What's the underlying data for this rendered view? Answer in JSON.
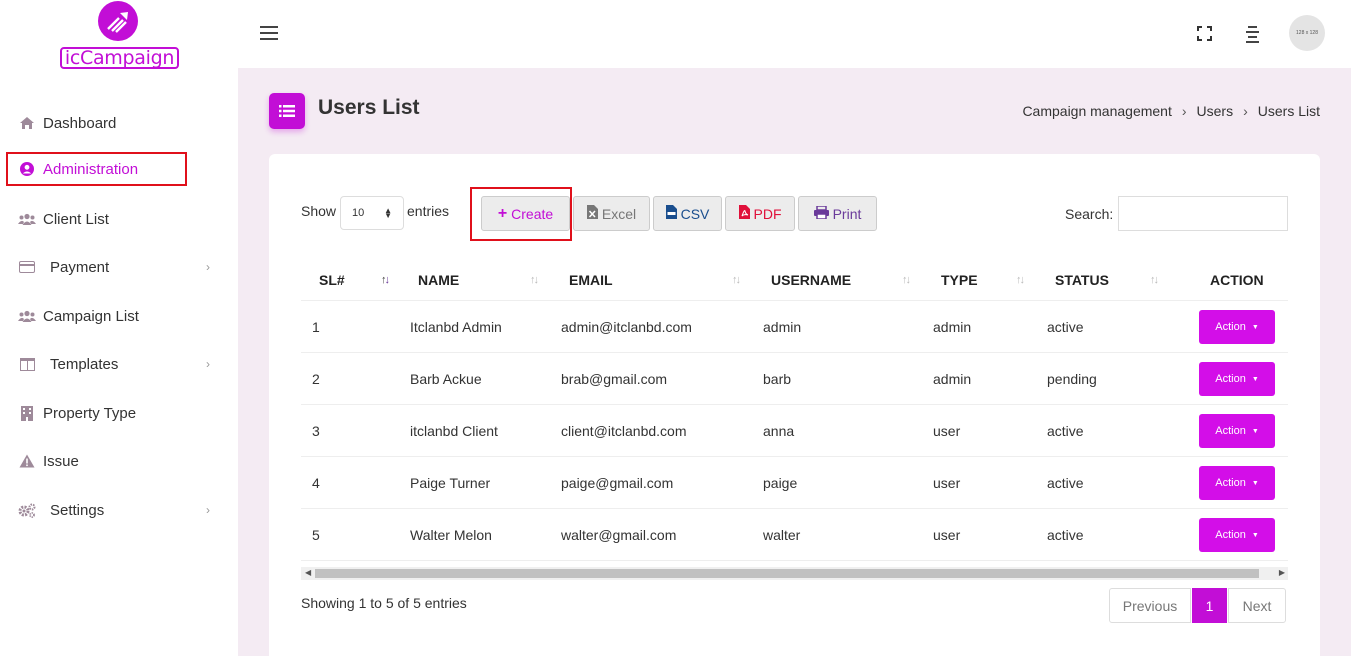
{
  "brand": {
    "name": "icCampaign",
    "accent": "#c20ed6"
  },
  "sidebar": {
    "items": [
      {
        "label": "Dashboard",
        "icon": "home-icon"
      },
      {
        "label": "Administration",
        "icon": "user-circle-icon"
      },
      {
        "label": "Client List",
        "icon": "users-icon"
      },
      {
        "label": "Payment",
        "icon": "credit-card-icon"
      },
      {
        "label": "Campaign List",
        "icon": "users-icon"
      },
      {
        "label": "Templates",
        "icon": "columns-icon"
      },
      {
        "label": "Property Type",
        "icon": "building-icon"
      },
      {
        "label": "Issue",
        "icon": "warning-icon"
      },
      {
        "label": "Settings",
        "icon": "cogs-icon"
      }
    ]
  },
  "topbar": {
    "avatar_text": "128 x 128"
  },
  "page": {
    "title": "Users List",
    "breadcrumb": [
      "Campaign management",
      "Users",
      "Users List"
    ]
  },
  "controls": {
    "show_label": "Show",
    "page_length": "10",
    "entries_label": "entries",
    "buttons": {
      "create": "Create",
      "excel": "Excel",
      "csv": "CSV",
      "pdf": "PDF",
      "print": "Print"
    },
    "search_label": "Search:",
    "search_value": ""
  },
  "table": {
    "columns": [
      "SL#",
      "NAME",
      "EMAIL",
      "USERNAME",
      "TYPE",
      "STATUS",
      "ACTION"
    ],
    "rows": [
      {
        "sl": "1",
        "name": "Itclanbd Admin",
        "email": "admin@itclanbd.com",
        "username": "admin",
        "type": "admin",
        "status": "active",
        "action": "Action"
      },
      {
        "sl": "2",
        "name": "Barb Ackue",
        "email": "brab@gmail.com",
        "username": "barb",
        "type": "admin",
        "status": "pending",
        "action": "Action"
      },
      {
        "sl": "3",
        "name": "itclanbd Client",
        "email": "client@itclanbd.com",
        "username": "anna",
        "type": "user",
        "status": "active",
        "action": "Action"
      },
      {
        "sl": "4",
        "name": "Paige Turner",
        "email": "paige@gmail.com",
        "username": "paige",
        "type": "user",
        "status": "active",
        "action": "Action"
      },
      {
        "sl": "5",
        "name": "Walter Melon",
        "email": "walter@gmail.com",
        "username": "walter",
        "type": "user",
        "status": "active",
        "action": "Action"
      }
    ]
  },
  "footer": {
    "info": "Showing 1 to 5 of 5 entries",
    "previous": "Previous",
    "current_page": "1",
    "next": "Next"
  }
}
